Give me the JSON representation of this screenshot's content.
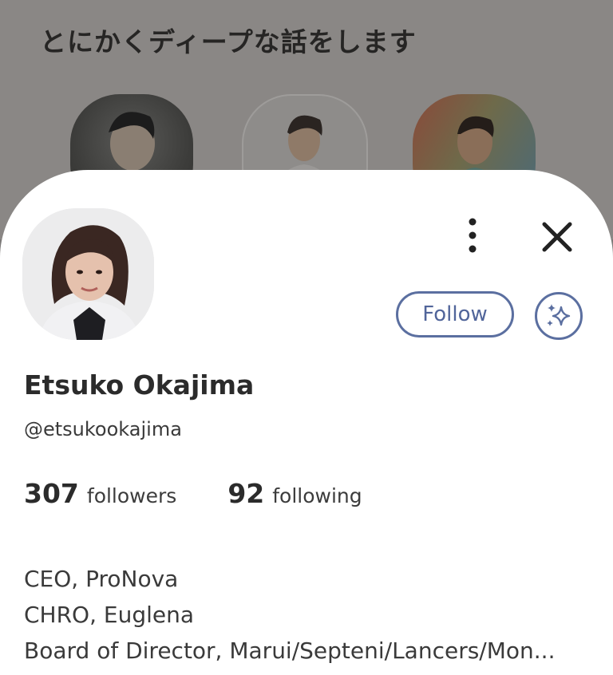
{
  "room": {
    "title": "とにかくディープな話をします",
    "speakers": [
      {
        "avatar": "speaker-1-photo"
      },
      {
        "avatar": "speaker-2-photo"
      },
      {
        "avatar": "speaker-3-photo"
      }
    ]
  },
  "profile": {
    "name": "Etsuko Okajima",
    "handle": "@etsukookajima",
    "followers_count": "307",
    "followers_label": "followers",
    "following_count": "92",
    "following_label": "following",
    "bio_lines": [
      "CEO, ProNova",
      "CHRO, Euglena",
      "Board of Director, Marui/Septeni/Lancers/Mon..."
    ],
    "follow_label": "Follow",
    "icons": {
      "more": "more-vertical-icon",
      "close": "close-icon",
      "sparkle": "sparkle-icon"
    }
  },
  "colors": {
    "accent": "#5b6fa0",
    "dim_background": "#7c7a79",
    "sheet": "#ffffff",
    "text_primary": "#2b2b2b"
  }
}
